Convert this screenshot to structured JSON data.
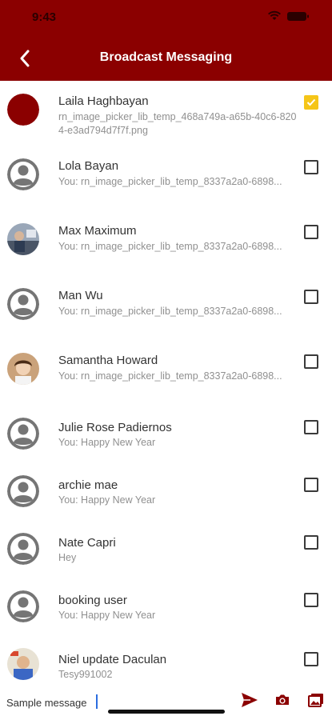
{
  "status_bar": {
    "time": "9:43"
  },
  "header": {
    "title": "Broadcast Messaging"
  },
  "contacts": [
    {
      "name": "Laila Haghbayan",
      "sub": "rn_image_picker_lib_temp_468a749a-a65b-40c6-8204-e3ad794d7f7f.png",
      "checked": true,
      "avatar": "solid"
    },
    {
      "name": "Lola Bayan",
      "sub": "You: rn_image_picker_lib_temp_8337a2a0-6898...",
      "checked": false,
      "avatar": "default"
    },
    {
      "name": "Max Maximum",
      "sub": "You: rn_image_picker_lib_temp_8337a2a0-6898...",
      "checked": false,
      "avatar": "photo"
    },
    {
      "name": "Man Wu",
      "sub": "You: rn_image_picker_lib_temp_8337a2a0-6898...",
      "checked": false,
      "avatar": "default"
    },
    {
      "name": "Samantha Howard",
      "sub": "You: rn_image_picker_lib_temp_8337a2a0-6898...",
      "checked": false,
      "avatar": "photo"
    },
    {
      "name": "Julie Rose Padiernos",
      "sub": "You: Happy  New Year",
      "checked": false,
      "avatar": "default"
    },
    {
      "name": "archie mae",
      "sub": "You: Happy  New Year",
      "checked": false,
      "avatar": "default"
    },
    {
      "name": "Nate Capri",
      "sub": "Hey",
      "checked": false,
      "avatar": "default"
    },
    {
      "name": "booking user",
      "sub": "You: Happy  New Year",
      "checked": false,
      "avatar": "default"
    },
    {
      "name": "Niel update Daculan",
      "sub": "Tesy991002",
      "checked": false,
      "avatar": "photo"
    }
  ],
  "composer": {
    "value": "Sample message"
  },
  "icons": {
    "back": "chevron-left-icon",
    "send": "send-icon",
    "camera": "camera-icon",
    "gallery": "gallery-icon"
  },
  "colors": {
    "header": "#8b0000",
    "checked": "#f5c518",
    "avatar_solid": "#8b0000",
    "avatar_default": "#757575"
  }
}
